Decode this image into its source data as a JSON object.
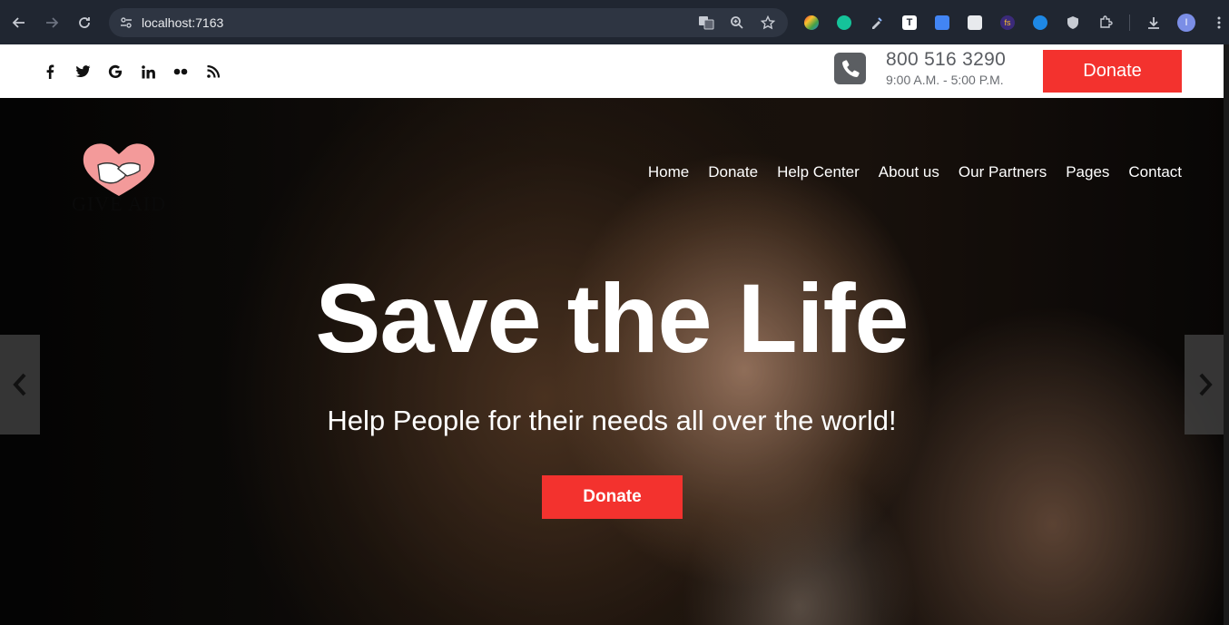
{
  "browser": {
    "url": "localhost:7163",
    "profile_initial": "I"
  },
  "topbar": {
    "socials": [
      "f",
      "twitter",
      "G",
      "in",
      "••",
      "rss"
    ],
    "phone": "800 516 3290",
    "hours": "9:00 A.M. - 5:00 P.M.",
    "donate_label": "Donate"
  },
  "logo": {
    "text": "GIVE AID"
  },
  "nav": {
    "items": [
      "Home",
      "Donate",
      "Help Center",
      "About us",
      "Our Partners",
      "Pages",
      "Contact"
    ]
  },
  "hero": {
    "title": "Save the Life",
    "subtitle": "Help People for their needs all over the world!",
    "donate_label": "Donate"
  },
  "colors": {
    "accent": "#f3322e",
    "chrome": "#202631"
  }
}
